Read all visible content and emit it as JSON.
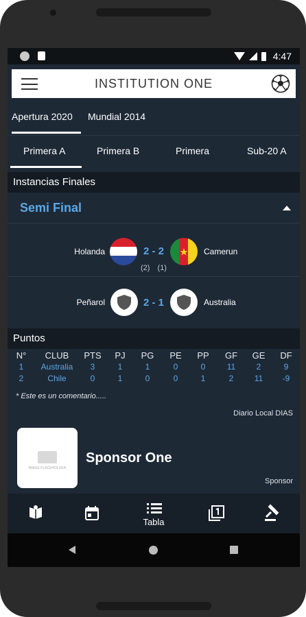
{
  "status_bar": {
    "time": "4:47"
  },
  "app_bar": {
    "title": "INSTITUTION  ONE"
  },
  "tournament_tabs": [
    {
      "label": "Apertura 2020",
      "selected": true
    },
    {
      "label": "Mundial 2014",
      "selected": false
    }
  ],
  "division_tabs": [
    {
      "label": "Primera A",
      "selected": true
    },
    {
      "label": "Primera B",
      "selected": false
    },
    {
      "label": "Primera",
      "selected": false
    },
    {
      "label": "Sub-20 A",
      "selected": false
    }
  ],
  "finals": {
    "heading": "Instancias Finales",
    "stage": "Semi Final",
    "matches": [
      {
        "home": "Holanda",
        "score": "2 - 2",
        "away": "Camerun",
        "home_pen": "(2)",
        "away_pen": "(1)"
      },
      {
        "home": "Peñarol",
        "score": "2 - 1",
        "away": "Australia"
      }
    ]
  },
  "points": {
    "heading": "Puntos",
    "columns": [
      "N°",
      "CLUB",
      "PTS",
      "PJ",
      "PG",
      "PE",
      "PP",
      "GF",
      "GE",
      "DF"
    ],
    "rows": [
      [
        "1",
        "Australia",
        "3",
        "1",
        "1",
        "0",
        "0",
        "11",
        "2",
        "9"
      ],
      [
        "2",
        "Chile",
        "0",
        "1",
        "0",
        "0",
        "1",
        "2",
        "11",
        "-9"
      ]
    ],
    "comment": "* Este es un comentario.....",
    "source": "Diario Local DIAS"
  },
  "sponsor": {
    "image_text": "IMAGE PLACEHOLDER",
    "name": "Sponsor One",
    "tag": "Sponsor"
  },
  "bottom_nav": {
    "items": [
      {
        "icon": "book-icon"
      },
      {
        "icon": "calendar-icon"
      },
      {
        "icon": "list-icon",
        "label": "Tabla",
        "active": true
      },
      {
        "icon": "filter-1-icon"
      },
      {
        "icon": "gavel-icon"
      }
    ]
  },
  "colors": {
    "background": "#1e2936",
    "accent": "#5aa7e6",
    "section_header": "#141b22",
    "bottom_nav": "#171f28"
  }
}
